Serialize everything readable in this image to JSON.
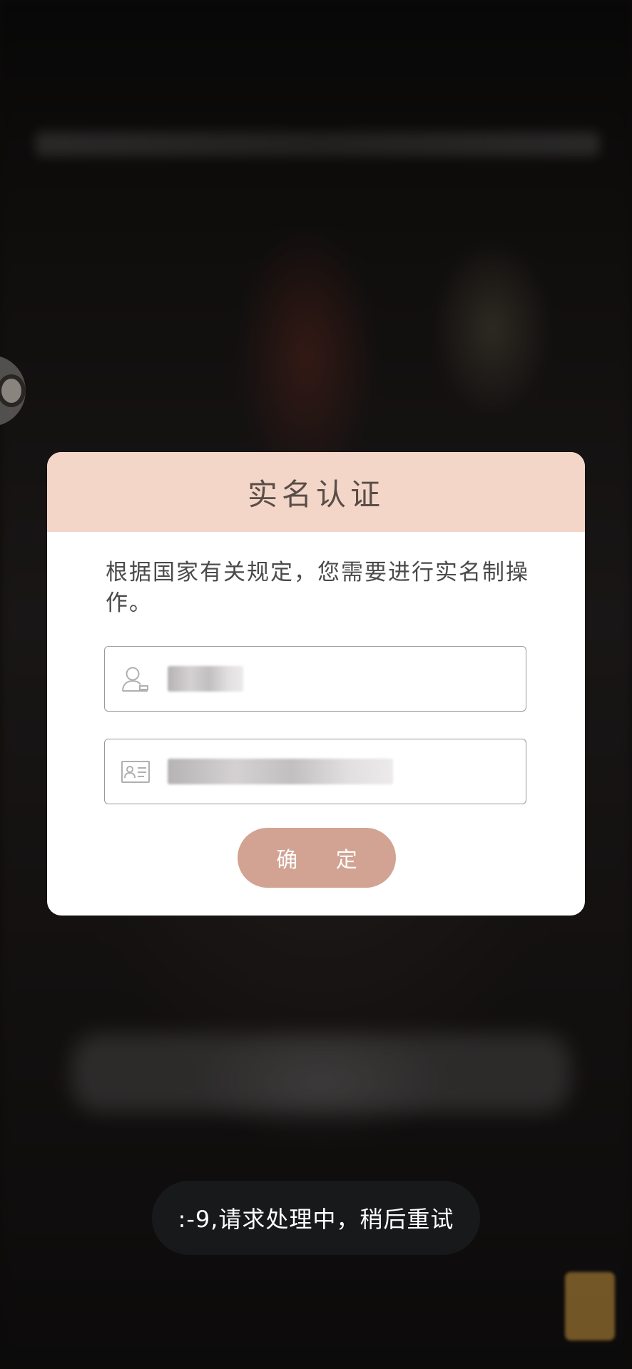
{
  "dialog": {
    "title": "实名认证",
    "message": "根据国家有关规定，您需要进行实名制操作。",
    "name_field": {
      "value": "",
      "placeholder": ""
    },
    "id_field": {
      "value": "",
      "placeholder": ""
    },
    "confirm_label": "确 定"
  },
  "toast": {
    "text": ":-9,请求处理中，稍后重试"
  },
  "icons": {
    "name_field_icon": "user-icon",
    "id_field_icon": "id-card-icon",
    "floating_ball_icon": "floating-ball-icon"
  },
  "colors": {
    "header_bg": "#f3d6c8",
    "button_bg": "#d2a392",
    "toast_bg": "#181a1c"
  }
}
